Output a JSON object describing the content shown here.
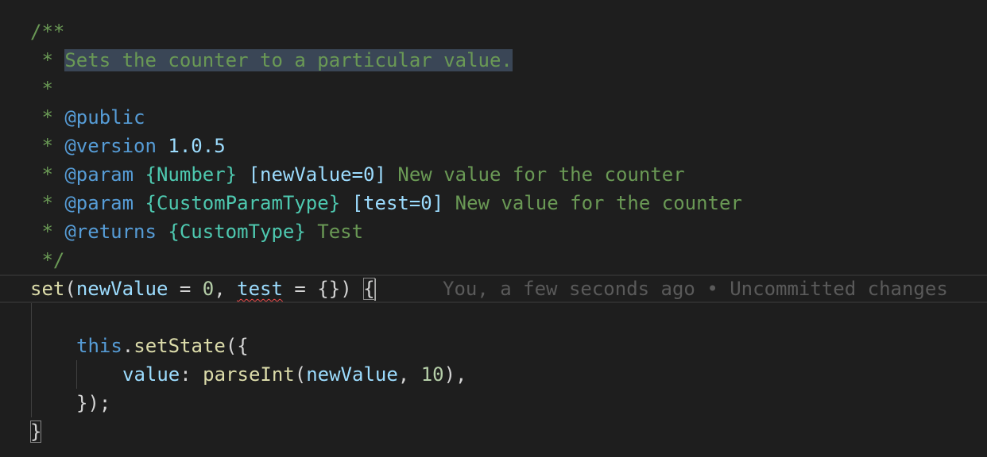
{
  "editor": {
    "lines": {
      "l1": {
        "open": "/**"
      },
      "l2": {
        "star": " * ",
        "selected_text": "Sets the counter to a particular value."
      },
      "l3": {
        "star": " *"
      },
      "l4": {
        "star": " * ",
        "tag": "@public"
      },
      "l5": {
        "star": " * ",
        "tag": "@version",
        "value": "1.0.5"
      },
      "l6": {
        "star": " * ",
        "tag": "@param",
        "type": "{Number}",
        "name": "[newValue=0]",
        "desc": "New value for the counter"
      },
      "l7": {
        "star": " * ",
        "tag": "@param",
        "type": "{CustomParamType}",
        "name": "[test=0]",
        "desc": "New value for the counter"
      },
      "l8": {
        "star": " * ",
        "tag": "@returns",
        "type": "{CustomType}",
        "desc": "Test"
      },
      "l9": {
        "close": " */"
      },
      "l10": {
        "fn": "set",
        "paren_open": "(",
        "arg1": "newValue",
        "eq1": " = ",
        "default1": "0",
        "comma": ", ",
        "arg2": "test",
        "eq2": " = ",
        "default2": "{}",
        "paren_close": ") ",
        "brace": "{"
      },
      "l12": {
        "this": "this",
        "dot": ".",
        "method": "setState",
        "open": "({"
      },
      "l13": {
        "key": "value",
        "colon": ": ",
        "fn": "parseInt",
        "paren_open": "(",
        "arg": "newValue",
        "comma": ", ",
        "num": "10",
        "close": "),"
      },
      "l14": {
        "close": "});"
      },
      "l15": {
        "brace": "}"
      }
    },
    "blame": "You, a few seconds ago • Uncommitted changes"
  }
}
